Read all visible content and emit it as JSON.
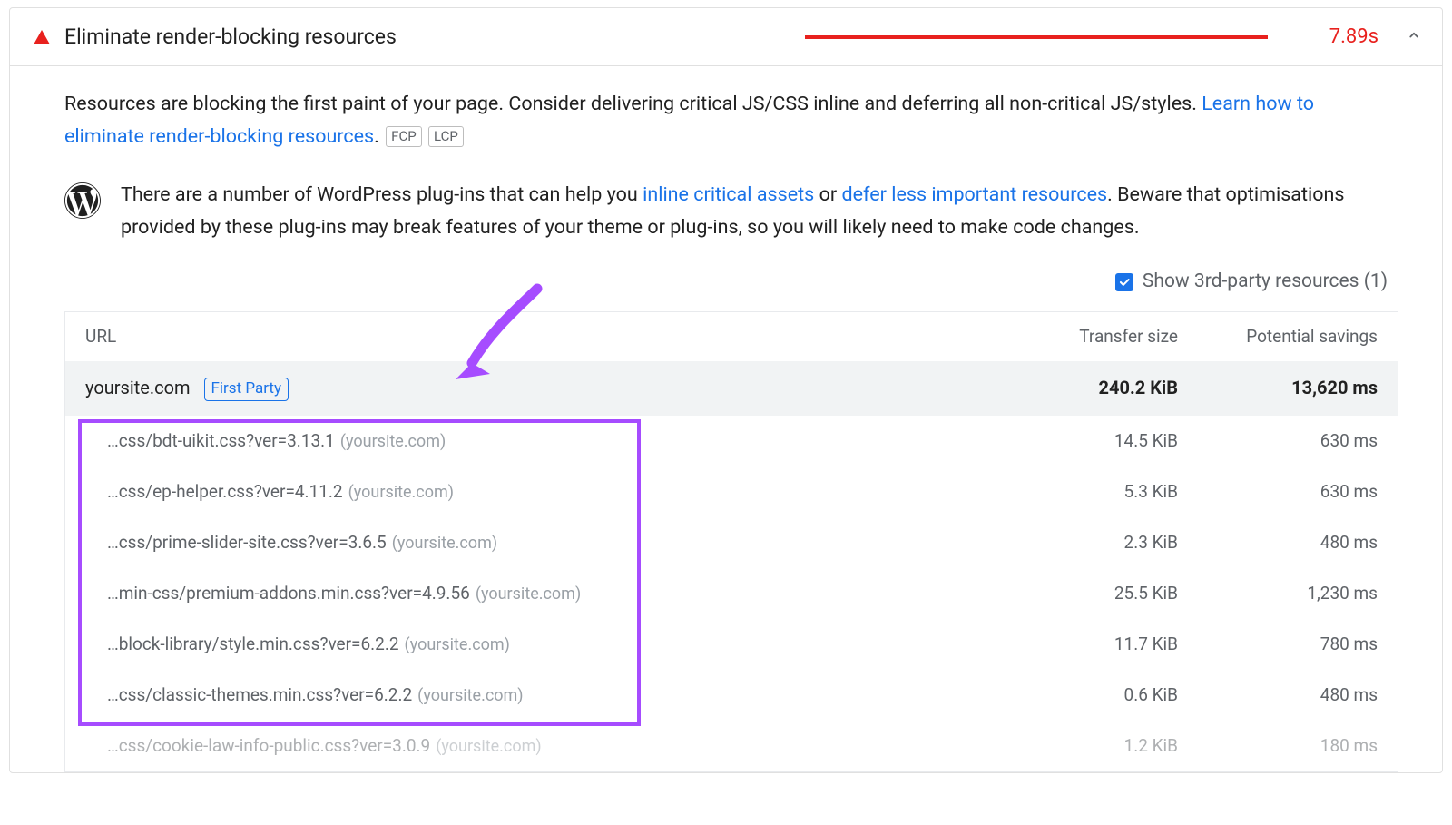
{
  "header": {
    "title": "Eliminate render-blocking resources",
    "metric": "7.89s"
  },
  "description": {
    "text_before_link": "Resources are blocking the first paint of your page. Consider delivering critical JS/CSS inline and deferring all non-critical JS/styles. ",
    "link_text": "Learn how to eliminate render-blocking resources",
    "period": ".",
    "tag1": "FCP",
    "tag2": "LCP"
  },
  "platform_note": {
    "before_link1": "There are a number of WordPress plug-ins that can help you ",
    "link1": "inline critical assets",
    "between": " or ",
    "link2": "defer less important resources",
    "after": ". Beware that optimisations provided by these plug-ins may break features of your theme or plug-ins, so you will likely need to make code changes."
  },
  "checkbox_label": "Show 3rd-party resources (1)",
  "columns": {
    "url": "URL",
    "transfer": "Transfer size",
    "savings": "Potential savings"
  },
  "group": {
    "host": "yoursite.com",
    "chip": "First Party",
    "transfer": "240.2 KiB",
    "savings": "13,620 ms"
  },
  "rows": [
    {
      "url": "…css/bdt-uikit.css?ver=3.13.1",
      "origin": "(yoursite.com)",
      "transfer": "14.5 KiB",
      "savings": "630 ms"
    },
    {
      "url": "…css/ep-helper.css?ver=4.11.2",
      "origin": "(yoursite.com)",
      "transfer": "5.3 KiB",
      "savings": "630 ms"
    },
    {
      "url": "…css/prime-slider-site.css?ver=3.6.5",
      "origin": "(yoursite.com)",
      "transfer": "2.3 KiB",
      "savings": "480 ms"
    },
    {
      "url": "…min-css/premium-addons.min.css?ver=4.9.56",
      "origin": "(yoursite.com)",
      "transfer": "25.5 KiB",
      "savings": "1,230 ms"
    },
    {
      "url": "…block-library/style.min.css?ver=6.2.2",
      "origin": "(yoursite.com)",
      "transfer": "11.7 KiB",
      "savings": "780 ms"
    },
    {
      "url": "…css/classic-themes.min.css?ver=6.2.2",
      "origin": "(yoursite.com)",
      "transfer": "0.6 KiB",
      "savings": "480 ms"
    },
    {
      "url": "…css/cookie-law-info-public.css?ver=3.0.9",
      "origin": "(yoursite.com)",
      "transfer": "1.2 KiB",
      "savings": "180 ms",
      "faded": true
    }
  ]
}
